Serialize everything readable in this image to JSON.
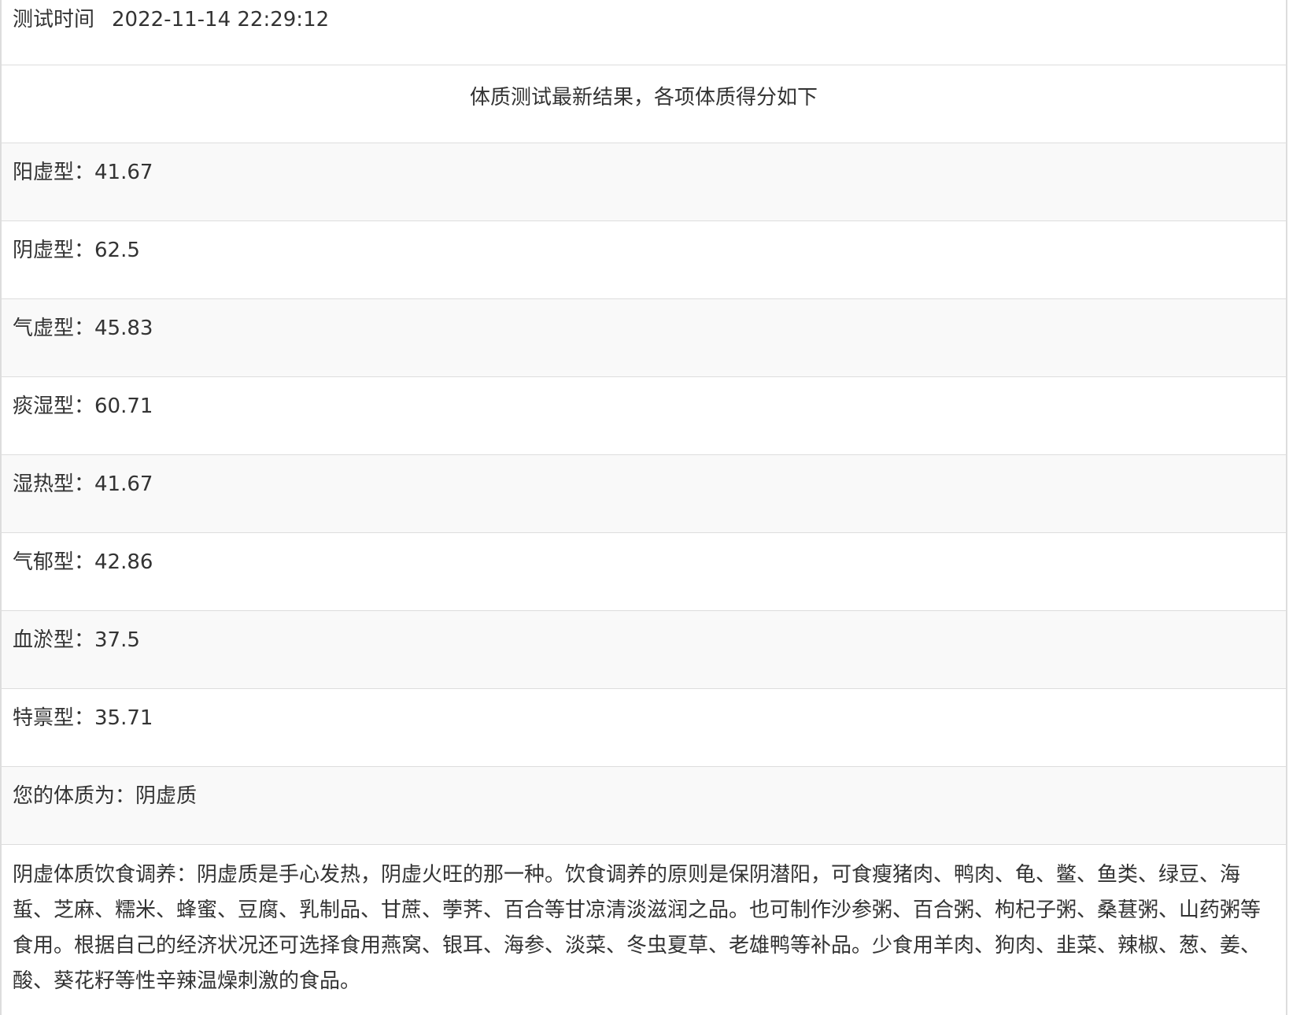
{
  "test_time": {
    "label": "测试时间",
    "value": "2022-11-14 22:29:12"
  },
  "header": {
    "title": "体质测试最新结果，各项体质得分如下"
  },
  "scores": [
    {
      "text": "阳虚型：41.67"
    },
    {
      "text": "阴虚型：62.5"
    },
    {
      "text": "气虚型：45.83"
    },
    {
      "text": "痰湿型：60.71"
    },
    {
      "text": "湿热型：41.67"
    },
    {
      "text": "气郁型：42.86"
    },
    {
      "text": "血淤型：37.5"
    },
    {
      "text": "特禀型：35.71"
    }
  ],
  "result": {
    "text": "您的体质为：阴虚质"
  },
  "advice": {
    "text": "阴虚体质饮食调养：阴虚质是手心发热，阴虚火旺的那一种。饮食调养的原则是保阴潜阳，可食瘦猪肉、鸭肉、龟、鳖、鱼类、绿豆、海蜇、芝麻、糯米、蜂蜜、豆腐、乳制品、甘蔗、荸荠、百合等甘凉清淡滋润之品。也可制作沙参粥、百合粥、枸杞子粥、桑葚粥、山药粥等食用。根据自己的经济状况还可选择食用燕窝、银耳、海参、淡菜、冬虫夏草、老雄鸭等补品。少食用羊肉、狗肉、韭菜、辣椒、葱、姜、酸、葵花籽等性辛辣温燥刺激的食品。"
  }
}
